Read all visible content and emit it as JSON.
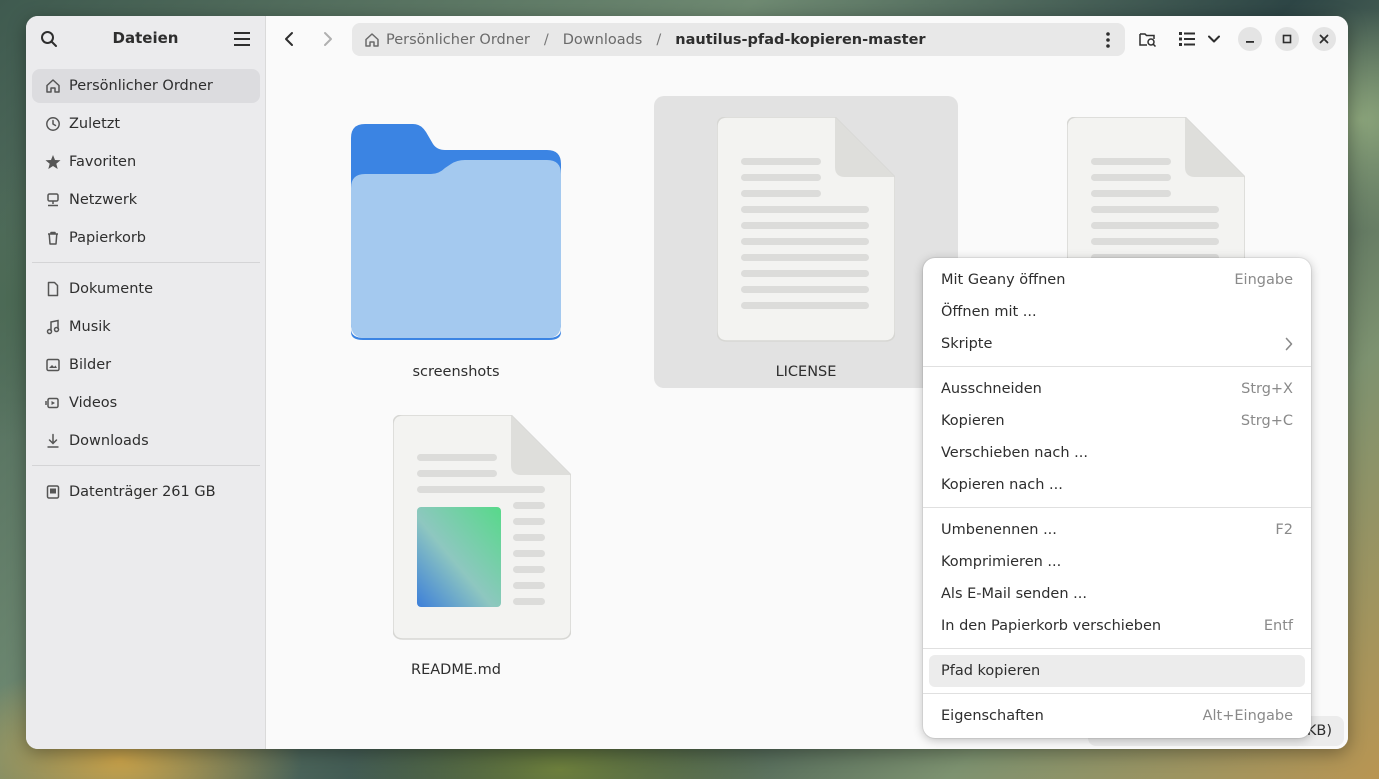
{
  "window": {
    "title": "Dateien"
  },
  "sidebar": {
    "places": [
      {
        "label": "Persönlicher Ordner",
        "icon": "home-icon",
        "active": true
      },
      {
        "label": "Zuletzt",
        "icon": "clock-icon"
      },
      {
        "label": "Favoriten",
        "icon": "star-icon"
      },
      {
        "label": "Netzwerk",
        "icon": "network-icon"
      },
      {
        "label": "Papierkorb",
        "icon": "trash-icon"
      }
    ],
    "bookmarks": [
      {
        "label": "Dokumente",
        "icon": "document-icon"
      },
      {
        "label": "Musik",
        "icon": "music-icon"
      },
      {
        "label": "Bilder",
        "icon": "image-icon"
      },
      {
        "label": "Videos",
        "icon": "video-icon"
      },
      {
        "label": "Downloads",
        "icon": "download-icon"
      }
    ],
    "devices": [
      {
        "label": "Datenträger 261 GB",
        "icon": "drive-icon"
      }
    ]
  },
  "pathbar": {
    "crumbs": [
      "Persönlicher Ordner",
      "Downloads",
      "nautilus-pfad-kopieren-master"
    ]
  },
  "files": [
    {
      "name": "screenshots",
      "type": "folder"
    },
    {
      "name": "LICENSE",
      "type": "text",
      "selected": true
    },
    {
      "name": "",
      "type": "text"
    },
    {
      "name": "README.md",
      "type": "markdown"
    }
  ],
  "context_menu": {
    "items": [
      {
        "label": "Mit Geany öffnen",
        "shortcut": "Eingabe"
      },
      {
        "label": "Öffnen mit ...",
        "shortcut": ""
      },
      {
        "label": "Skripte",
        "submenu": true
      },
      {
        "label": "Ausschneiden",
        "shortcut": "Strg+X"
      },
      {
        "label": "Kopieren",
        "shortcut": "Strg+C"
      },
      {
        "label": "Verschieben nach ...",
        "shortcut": ""
      },
      {
        "label": "Kopieren nach ...",
        "shortcut": ""
      },
      {
        "label": "Umbenennen ...",
        "shortcut": "F2"
      },
      {
        "label": "Komprimieren ...",
        "shortcut": ""
      },
      {
        "label": "Als E-Mail senden ...",
        "shortcut": ""
      },
      {
        "label": "In den Papierkorb verschieben",
        "shortcut": "Entf"
      },
      {
        "label": "Pfad kopieren",
        "shortcut": "",
        "highlighted": true
      },
      {
        "label": "Eigenschaften",
        "shortcut": "Alt+Eingabe"
      }
    ]
  },
  "statusbar": {
    "text": "KB)"
  },
  "colors": {
    "folder_dark": "#3b84e3",
    "folder_light": "#a4c9ef",
    "selection": "#e2e2e2"
  }
}
